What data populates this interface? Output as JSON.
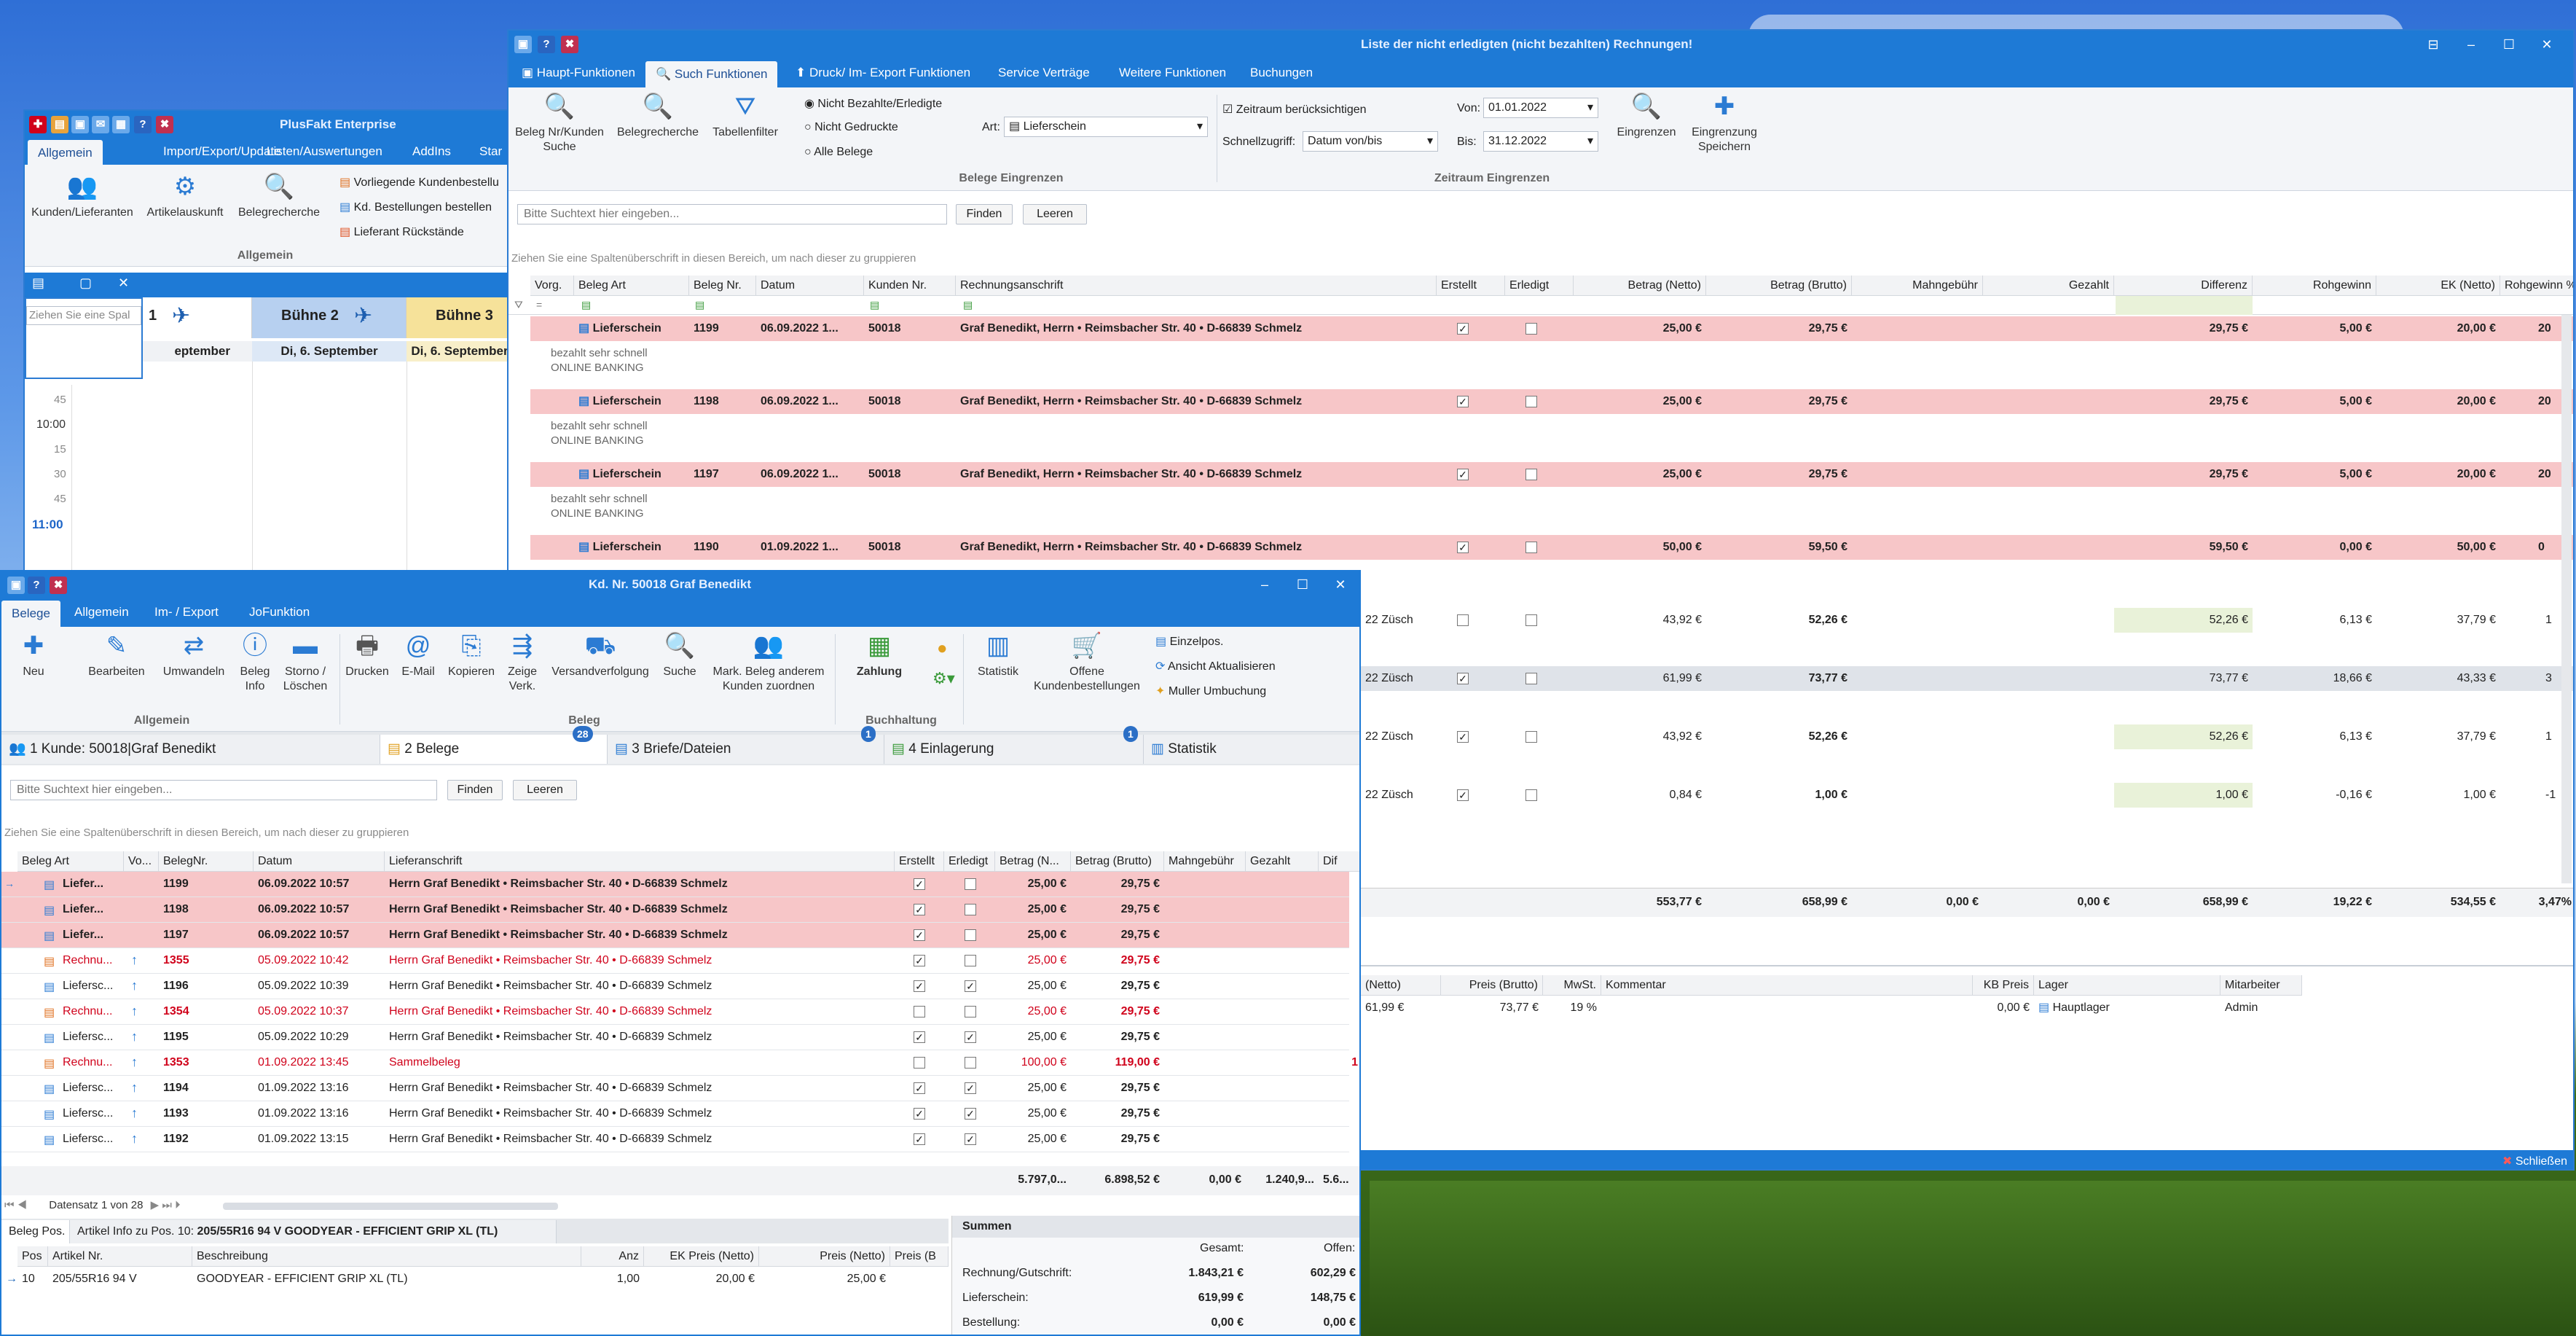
{
  "desktop": {
    "bg": "#3a7bd5"
  },
  "plusfakt": {
    "title": "PlusFakt Enterprise",
    "menu": [
      "Allgemein",
      "Import/Export/Update",
      "Listen/Auswertungen",
      "AddIns",
      "Star"
    ],
    "buttons": [
      "Kunden/Lieferanten",
      "Artikelauskunft",
      "Belegrecherche"
    ],
    "side": [
      "Vorliegende Kundenbestellu",
      "Kd. Bestellungen bestellen",
      "Lieferant Rückstände"
    ],
    "group": "Allgemein"
  },
  "calendar": {
    "search_placeholder": "Ziehen Sie eine Spal",
    "days": [
      {
        "name": "1",
        "date": "eptember"
      },
      {
        "name": "Bühne 2",
        "date": "Di, 6. September"
      },
      {
        "name": "Bühne 3",
        "date": "Di, 6. September"
      }
    ],
    "times": [
      "45",
      "10:00",
      "15",
      "30",
      "45",
      "11:00",
      "15"
    ]
  },
  "invoices": {
    "title": "Liste der nicht erledigten (nicht bezahlten) Rechnungen!",
    "menu": [
      "Haupt-Funktionen",
      "Such Funktionen",
      "Druck/ Im- Export Funktionen",
      "Service Verträge",
      "Weitere Funktionen",
      "Buchungen"
    ],
    "btn_search_customer": "Beleg Nr/Kunden Suche",
    "btn_beleg": "Belegrecherche",
    "btn_filter": "Tabellenfilter",
    "radio": [
      "Nicht Bezahlte/Erledigte",
      "Nicht Gedruckte",
      "Alle Belege"
    ],
    "art_label": "Art:",
    "art_value": "Lieferschein",
    "group1": "Belege Eingrenzen",
    "zeitraum_chk": "Zeitraum berücksichtigen",
    "schnell_label": "Schnellzugriff:",
    "schnell_value": "Datum von/bis",
    "von_label": "Von:",
    "von": "01.01.2022",
    "bis_label": "Bis:",
    "bis": "31.12.2022",
    "eingrenzen": "Eingrenzen",
    "speichern": "Eingrenzung Speichern",
    "group2": "Zeitraum Eingrenzen",
    "search_placeholder": "Bitte Suchtext hier eingeben...",
    "find": "Finden",
    "clear": "Leeren",
    "hint": "Ziehen Sie eine Spaltenüberschrift in diesen Bereich, um nach dieser zu gruppieren",
    "cols": [
      "Vorg.",
      "Beleg Art",
      "Beleg Nr.",
      "Datum",
      "Kunden Nr.",
      "Rechnungsanschrift",
      "Erstellt",
      "Erledigt",
      "Betrag (Netto)",
      "Betrag (Brutto)",
      "Mahngebühr",
      "Gezahlt",
      "Differenz",
      "Rohgewinn",
      "EK (Netto)",
      "Rohgewinn %"
    ],
    "rows": [
      {
        "art": "Lieferschein",
        "nr": "1199",
        "date": "06.09.2022 1...",
        "kd": "50018",
        "addr": "Graf Benedikt, Herrn • Reimsbacher Str. 40 • D-66839 Schmelz",
        "netto": "25,00 €",
        "brutto": "29,75 €",
        "diff": "29,75 €",
        "roh": "5,00 €",
        "ek": "20,00 €",
        "pct": "20",
        "note1": "bezahlt sehr schnell",
        "note2": "ONLINE BANKING"
      },
      {
        "art": "Lieferschein",
        "nr": "1198",
        "date": "06.09.2022 1...",
        "kd": "50018",
        "addr": "Graf Benedikt, Herrn • Reimsbacher Str. 40 • D-66839 Schmelz",
        "netto": "25,00 €",
        "brutto": "29,75 €",
        "diff": "29,75 €",
        "roh": "5,00 €",
        "ek": "20,00 €",
        "pct": "20",
        "note1": "bezahlt sehr schnell",
        "note2": "ONLINE BANKING"
      },
      {
        "art": "Lieferschein",
        "nr": "1197",
        "date": "06.09.2022 1...",
        "kd": "50018",
        "addr": "Graf Benedikt, Herrn • Reimsbacher Str. 40 • D-66839 Schmelz",
        "netto": "25,00 €",
        "brutto": "29,75 €",
        "diff": "29,75 €",
        "roh": "5,00 €",
        "ek": "20,00 €",
        "pct": "20",
        "note1": "bezahlt sehr schnell",
        "note2": "ONLINE BANKING"
      },
      {
        "art": "Lieferschein",
        "nr": "1190",
        "date": "01.09.2022 1...",
        "kd": "50018",
        "addr": "Graf Benedikt, Herrn • Reimsbacher Str. 40 • D-66839 Schmelz",
        "netto": "50,00 €",
        "brutto": "59,50 €",
        "diff": "59,50 €",
        "roh": "0,00 €",
        "ek": "50,00 €",
        "pct": "0"
      }
    ],
    "rows2": [
      {
        "addr": "22 Züsch",
        "netto": "43,92 €",
        "brutto": "52,26 €",
        "diff": "52,26 €",
        "roh": "6,13 €",
        "ek": "37,79 €",
        "pct": "1"
      },
      {
        "addr": "22 Züsch",
        "netto": "61,99 €",
        "brutto": "73,77 €",
        "diff": "73,77 €",
        "roh": "18,66 €",
        "ek": "43,33 €",
        "pct": "3"
      },
      {
        "addr": "22 Züsch",
        "netto": "43,92 €",
        "brutto": "52,26 €",
        "diff": "52,26 €",
        "roh": "6,13 €",
        "ek": "37,79 €",
        "pct": "1"
      },
      {
        "addr": "22 Züsch",
        "netto": "0,84 €",
        "brutto": "1,00 €",
        "diff": "1,00 €",
        "roh": "-0,16 €",
        "ek": "1,00 €",
        "pct": "-1"
      }
    ],
    "totals": {
      "netto": "553,77 €",
      "brutto": "658,99 €",
      "mahn": "0,00 €",
      "gez": "0,00 €",
      "diff": "658,99 €",
      "roh": "19,22 €",
      "ek": "534,55 €",
      "pct": "3,47%"
    },
    "detail_cols": [
      "(Netto)",
      "Preis (Brutto)",
      "MwSt.",
      "Kommentar",
      "KB Preis",
      "Lager",
      "Mitarbeiter"
    ],
    "detail_row": [
      "61,99 €",
      "73,77 €",
      "19 %",
      "",
      "0,00 €",
      "Hauptlager",
      "Admin"
    ],
    "close": "Schließen"
  },
  "customer": {
    "title": "Kd. Nr. 50018 Graf Benedikt",
    "menu": [
      "Belege",
      "Allgemein",
      "Im- / Export",
      "JoFunktion"
    ],
    "tools": [
      "Neu",
      "Bearbeiten",
      "Umwandeln",
      "Beleg Info",
      "Storno / Löschen",
      "Drucken",
      "E-Mail",
      "Kopieren",
      "Zeige Verk.",
      "Versandverfolgung",
      "Suche",
      "Mark. Beleg anderem Kunden zuordnen",
      "Zahlung",
      "",
      "Statistik",
      "Offene Kundenbestellungen"
    ],
    "side": [
      "Einzelpos.",
      "Ansicht Aktualisieren",
      "Muller Umbuchung"
    ],
    "groups": [
      "Allgemein",
      "Beleg",
      "Buchhaltung"
    ],
    "tabs": [
      {
        "label": "1 Kunde: 50018|Graf Benedikt"
      },
      {
        "label": "2 Belege",
        "badge": "28"
      },
      {
        "label": "3 Briefe/Dateien",
        "badge": "1"
      },
      {
        "label": "4 Einlagerung",
        "badge": "1"
      },
      {
        "label": "Statistik"
      }
    ],
    "search_placeholder": "Bitte Suchtext hier eingeben...",
    "find": "Finden",
    "clear": "Leeren",
    "hint": "Ziehen Sie eine Spaltenüberschrift in diesen Bereich, um nach dieser zu gruppieren",
    "cols": [
      "Beleg Art",
      "Vo...",
      "BelegNr.",
      "Datum",
      "Lieferanschrift",
      "Erstellt",
      "Erledigt",
      "Betrag (N...",
      "Betrag (Brutto)",
      "Mahngebühr",
      "Gezahlt",
      "Dif"
    ],
    "rows": [
      {
        "art": "Liefer...",
        "nr": "1199",
        "date": "06.09.2022 10:57",
        "addr": "Herrn Graf Benedikt • Reimsbacher Str. 40 • D-66839 Schmelz",
        "e": true,
        "d": false,
        "n": "25,00 €",
        "b": "29,75 €",
        "style": "pink"
      },
      {
        "art": "Liefer...",
        "nr": "1198",
        "date": "06.09.2022 10:57",
        "addr": "Herrn Graf Benedikt • Reimsbacher Str. 40 • D-66839 Schmelz",
        "e": true,
        "d": false,
        "n": "25,00 €",
        "b": "29,75 €",
        "style": "pink"
      },
      {
        "art": "Liefer...",
        "nr": "1197",
        "date": "06.09.2022 10:57",
        "addr": "Herrn Graf Benedikt • Reimsbacher Str. 40 • D-66839 Schmelz",
        "e": true,
        "d": false,
        "n": "25,00 €",
        "b": "29,75 €",
        "style": "pink"
      },
      {
        "art": "Rechnu...",
        "nr": "1355",
        "date": "05.09.2022 10:42",
        "addr": "Herrn Graf Benedikt • Reimsbacher Str. 40 • D-66839 Schmelz",
        "e": true,
        "d": false,
        "n": "25,00 €",
        "b": "29,75 €",
        "style": "red"
      },
      {
        "art": "Liefersc...",
        "nr": "1196",
        "date": "05.09.2022 10:39",
        "addr": "Herrn Graf Benedikt • Reimsbacher Str. 40 • D-66839 Schmelz",
        "e": true,
        "d": true,
        "n": "25,00 €",
        "b": "29,75 €",
        "style": ""
      },
      {
        "art": "Rechnu...",
        "nr": "1354",
        "date": "05.09.2022 10:37",
        "addr": "Herrn Graf Benedikt • Reimsbacher Str. 40 • D-66839 Schmelz",
        "e": false,
        "d": false,
        "n": "25,00 €",
        "b": "29,75 €",
        "style": "red"
      },
      {
        "art": "Liefersc...",
        "nr": "1195",
        "date": "05.09.2022 10:29",
        "addr": "Herrn Graf Benedikt • Reimsbacher Str. 40 • D-66839 Schmelz",
        "e": true,
        "d": true,
        "n": "25,00 €",
        "b": "29,75 €",
        "style": ""
      },
      {
        "art": "Rechnu...",
        "nr": "1353",
        "date": "01.09.2022 13:45",
        "addr": "Sammelbeleg",
        "e": false,
        "d": false,
        "n": "100,00 €",
        "b": "119,00 €",
        "style": "red",
        "dif": "1"
      },
      {
        "art": "Liefersc...",
        "nr": "1194",
        "date": "01.09.2022 13:16",
        "addr": "Herrn Graf Benedikt • Reimsbacher Str. 40 • D-66839 Schmelz",
        "e": true,
        "d": true,
        "n": "25,00 €",
        "b": "29,75 €",
        "style": ""
      },
      {
        "art": "Liefersc...",
        "nr": "1193",
        "date": "01.09.2022 13:16",
        "addr": "Herrn Graf Benedikt • Reimsbacher Str. 40 • D-66839 Schmelz",
        "e": true,
        "d": true,
        "n": "25,00 €",
        "b": "29,75 €",
        "style": ""
      },
      {
        "art": "Liefersc...",
        "nr": "1192",
        "date": "01.09.2022 13:15",
        "addr": "Herrn Graf Benedikt • Reimsbacher Str. 40 • D-66839 Schmelz",
        "e": true,
        "d": true,
        "n": "25,00 €",
        "b": "29,75 €",
        "style": ""
      }
    ],
    "totals": {
      "n": "5.797,0...",
      "b": "6.898,52 €",
      "mahn": "0,00 €",
      "gez": "1.240,9...",
      "dif": "5.6..."
    },
    "pager": "Datensatz 1 von 28",
    "bottom_tabs": [
      "Beleg Pos.",
      "Artikel Info zu Pos. 10:",
      "205/55R16 94 V GOODYEAR - EFFICIENT GRIP XL (TL)"
    ],
    "pos_cols": [
      "Pos",
      "Artikel Nr.",
      "Beschreibung",
      "Anz",
      "EK Preis (Netto)",
      "Preis (Netto)",
      "Preis (B"
    ],
    "pos_row": [
      "10",
      "205/55R16 94 V",
      "GOODYEAR - EFFICIENT GRIP XL (TL)",
      "1,00",
      "20,00 €",
      "25,00 €",
      ""
    ],
    "sums": {
      "title": "Summen",
      "h1": "Gesamt:",
      "h2": "Offen:",
      "rows": [
        [
          "Rechnung/Gutschrift:",
          "1.843,21 €",
          "602,29 €"
        ],
        [
          "Lieferschein:",
          "619,99 €",
          "148,75 €"
        ],
        [
          "Bestellung:",
          "0,00 €",
          "0,00 €"
        ]
      ]
    }
  }
}
